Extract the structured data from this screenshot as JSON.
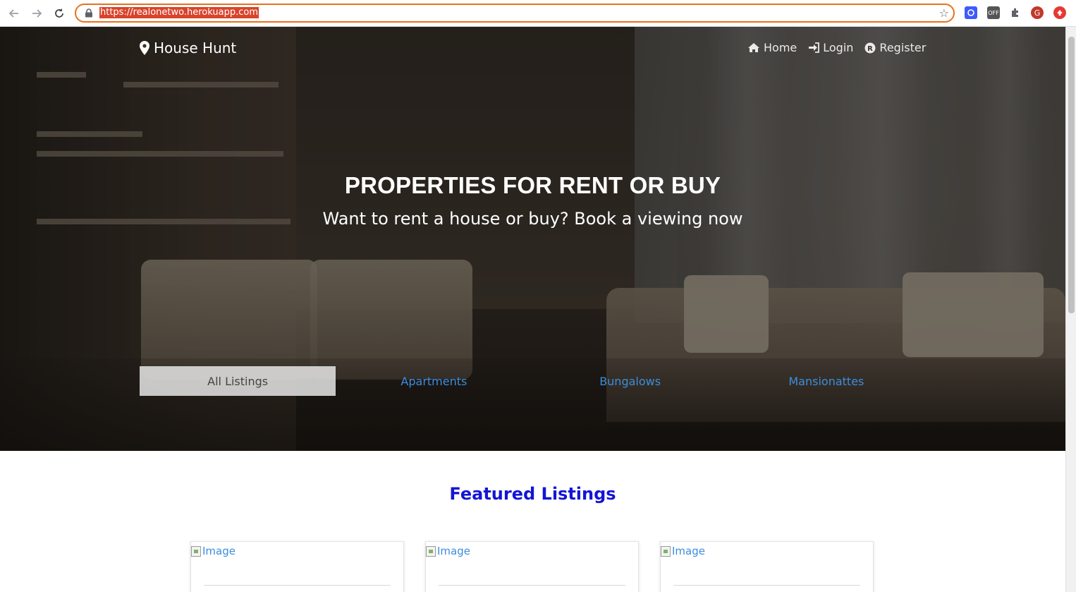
{
  "browser": {
    "url": "https://realonetwo.herokuapp.com",
    "profile_initial": "G",
    "ext_off_label": "OFF"
  },
  "nav": {
    "brand": "House Hunt",
    "links": [
      {
        "label": "Home",
        "icon": "home-icon"
      },
      {
        "label": "Login",
        "icon": "login-icon"
      },
      {
        "label": "Register",
        "icon": "register-icon"
      }
    ]
  },
  "hero": {
    "title": "PROPERTIES FOR RENT OR BUY",
    "subtitle": "Want to rent a house or buy? Book a viewing now"
  },
  "tabs": [
    {
      "label": "All Listings",
      "active": true
    },
    {
      "label": "Apartments",
      "active": false
    },
    {
      "label": "Bungalows",
      "active": false
    },
    {
      "label": "Mansionattes",
      "active": false
    }
  ],
  "featured": {
    "heading": "Featured Listings",
    "cards": [
      {
        "image_alt": "Image"
      },
      {
        "image_alt": "Image"
      },
      {
        "image_alt": "Image"
      }
    ]
  },
  "colors": {
    "link": "#3c8dde",
    "featured_heading": "#1414d6",
    "omnibox_focus": "#e8711c"
  }
}
